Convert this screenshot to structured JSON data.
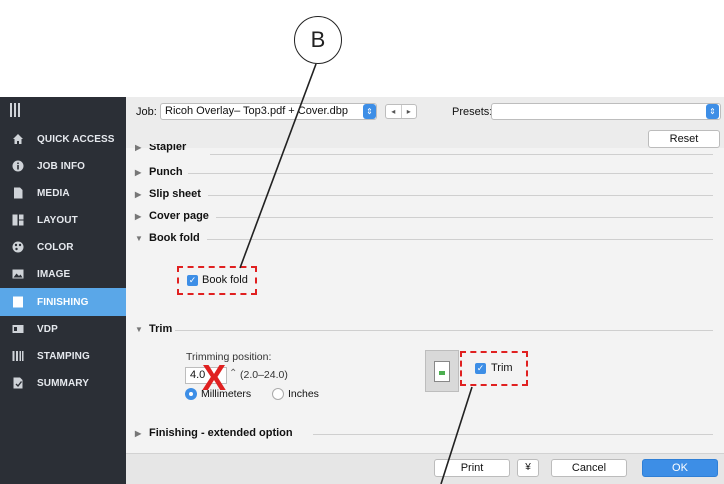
{
  "callout": {
    "label": "B"
  },
  "sidebar": {
    "items": [
      {
        "label": "QUICK ACCESS",
        "icon": "home-icon"
      },
      {
        "label": "JOB INFO",
        "icon": "info-icon"
      },
      {
        "label": "MEDIA",
        "icon": "document-icon"
      },
      {
        "label": "LAYOUT",
        "icon": "layout-icon"
      },
      {
        "label": "COLOR",
        "icon": "palette-icon"
      },
      {
        "label": "IMAGE",
        "icon": "image-icon"
      },
      {
        "label": "FINISHING",
        "icon": "finishing-icon",
        "active": true
      },
      {
        "label": "VDP",
        "icon": "vdp-icon"
      },
      {
        "label": "STAMPING",
        "icon": "stamp-icon"
      },
      {
        "label": "SUMMARY",
        "icon": "summary-icon"
      }
    ],
    "accent": "#5aa7e8"
  },
  "toolbar": {
    "job_label": "Job:",
    "job_value": "Ricoh Overlay– Top3.pdf + Cover.dbp",
    "nav_prev": "◂",
    "nav_next": "▸",
    "presets_label": "Presets:",
    "presets_value": "",
    "reset_label": "Reset"
  },
  "sections": {
    "stapler": "Stapler",
    "punch": "Punch",
    "slip_sheet": "Slip sheet",
    "cover_page": "Cover page",
    "book_fold": "Book fold",
    "trim": "Trim",
    "extended": "Finishing - extended option"
  },
  "book_fold": {
    "checkbox_label": "Book fold",
    "checked": true
  },
  "trim": {
    "position_label": "Trimming position:",
    "value": "4.0",
    "range": "(2.0–24.0)",
    "unit_options": [
      "Millimeters",
      "Inches"
    ],
    "selected_unit": "Millimeters",
    "checkbox_label": "Trim",
    "checked": true
  },
  "annotation": {
    "x_mark": "X",
    "x_color": "#e02020",
    "dash_color": "#e02020"
  },
  "footer": {
    "print_label": "Print",
    "print_menu": "¥",
    "cancel_label": "Cancel",
    "ok_label": "OK"
  }
}
